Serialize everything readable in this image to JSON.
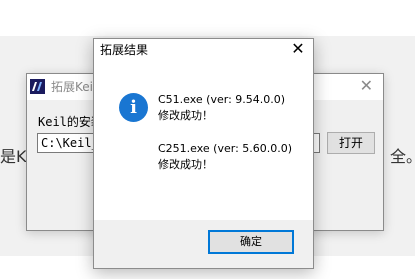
{
  "background_page": {
    "left_text": "是Ke",
    "right_text": "全。"
  },
  "keil_window": {
    "title": "拓展Keil",
    "path_label": "Keil的安装",
    "path_value": "C:\\Keil_v",
    "open_button": "打开",
    "close_glyph": "✕",
    "app_icon": "app-logo-icon"
  },
  "dialog": {
    "title": "拓展结果",
    "close_glyph": "✕",
    "icon": "info-icon",
    "icon_glyph": "i",
    "icon_color": "#1976d2",
    "messages": [
      {
        "exe": "C51.exe (ver: 9.54.0.0)",
        "status": "修改成功！"
      },
      {
        "exe": "C251.exe (ver: 5.60.0.0)",
        "status": "修改成功！"
      }
    ],
    "ok_button": "确定",
    "accent": "#0078d7"
  }
}
